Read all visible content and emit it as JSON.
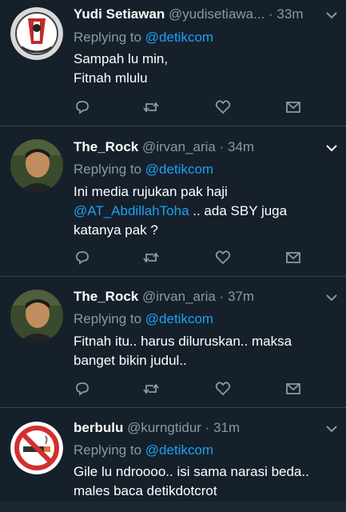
{
  "tweets": [
    {
      "name": "Yudi Setiawan",
      "handle": "@yudisetiawa...",
      "time": "· 33m",
      "reply_prefix": "Replying to ",
      "reply_to": "@detikcom",
      "lines": [
        "Sampah lu min,",
        "Fitnah mlulu"
      ],
      "avatar": "avatar-logo"
    },
    {
      "name": "The_Rock",
      "handle": "@irvan_aria",
      "time": "· 34m",
      "reply_prefix": "Replying to ",
      "reply_to": "@detikcom",
      "line1": "Ini media rujukan pak haji",
      "line2_mention": "@AT_AbdillahToha",
      "line2_rest": " .. ada SBY juga",
      "line3": "katanya pak ?",
      "avatar": "avatar-photo"
    },
    {
      "name": "The_Rock",
      "handle": "@irvan_aria",
      "time": "· 37m",
      "reply_prefix": "Replying to ",
      "reply_to": "@detikcom",
      "lines": [
        "Fitnah itu.. harus diluruskan.. maksa",
        "banget bikin judul.."
      ],
      "avatar": "avatar-photo"
    },
    {
      "name": "berbulu",
      "handle": "@kurngtidur",
      "time": "· 31m",
      "reply_prefix": "Replying to ",
      "reply_to": "@detikcom",
      "lines": [
        "Gile lu ndroooo.. isi sama narasi beda..",
        "males baca detikdotcrot"
      ],
      "avatar": "avatar-no-smoking"
    }
  ],
  "icons": {
    "reply": "reply-icon",
    "retweet": "retweet-icon",
    "like": "like-icon",
    "dm": "dm-icon",
    "more": "chevron-down-icon"
  },
  "colors": {
    "background": "#15202b",
    "text": "#ffffff",
    "secondary": "#8899a6",
    "link": "#1da1f2",
    "divider": "#38444d"
  }
}
